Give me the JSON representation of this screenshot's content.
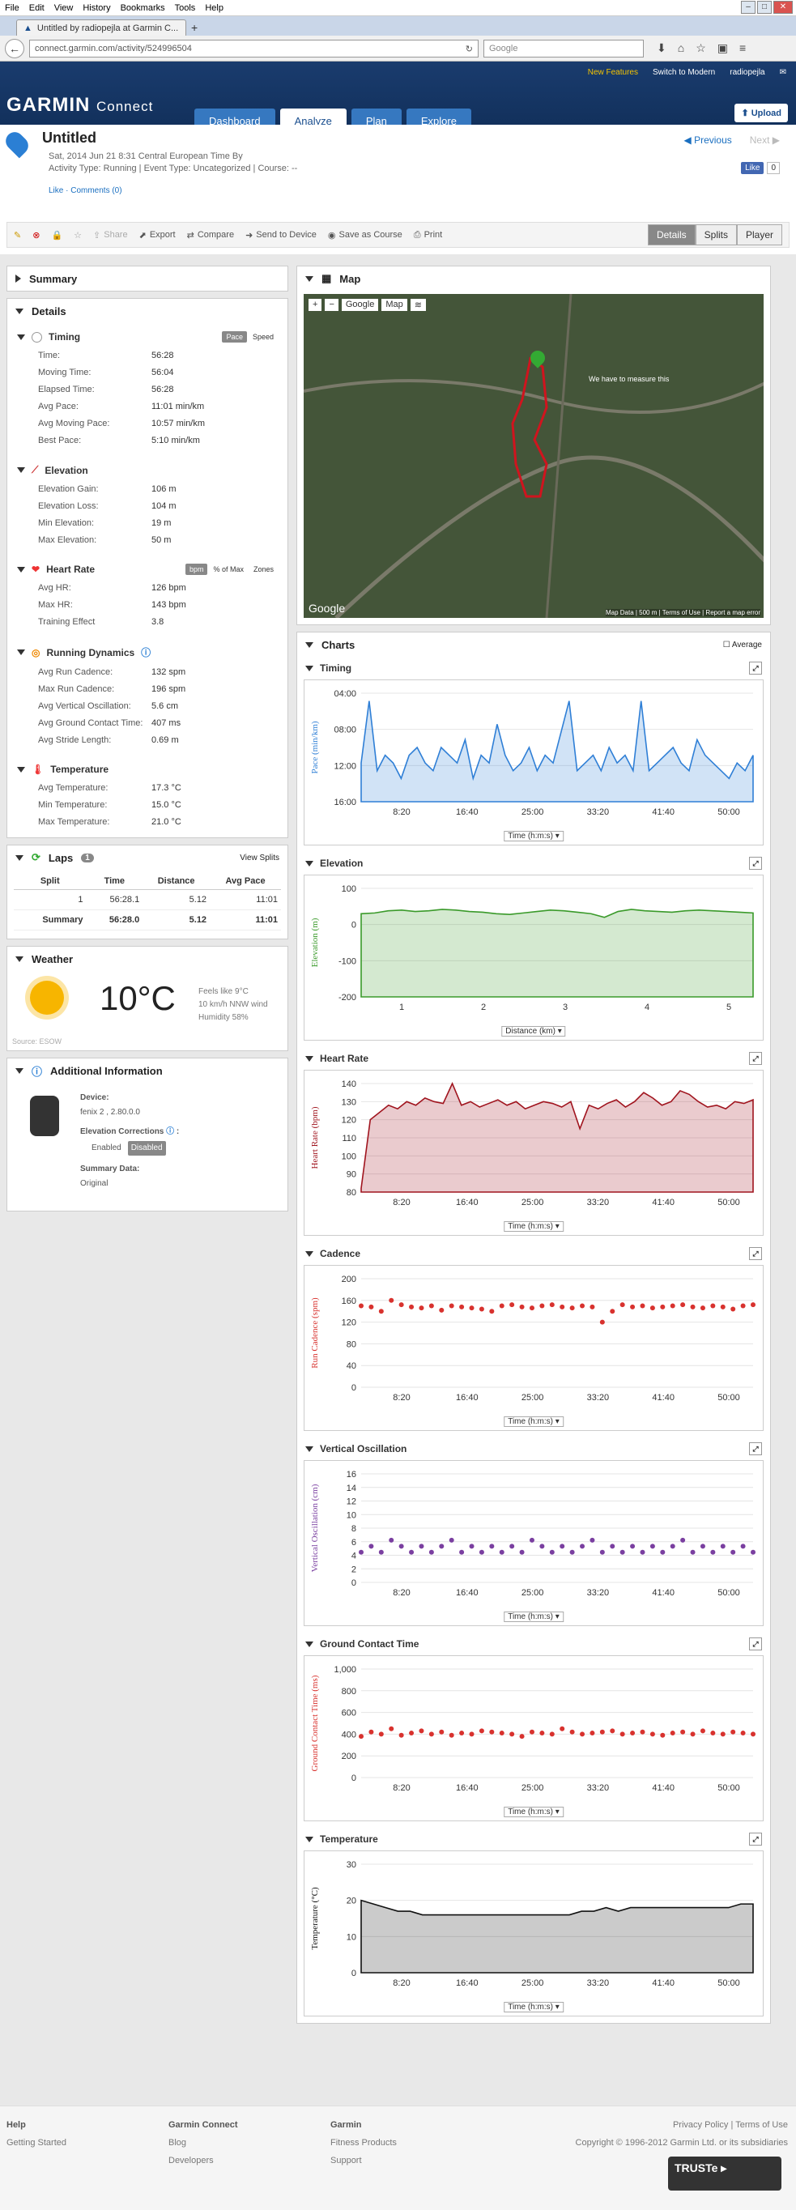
{
  "browser": {
    "menu": [
      "File",
      "Edit",
      "View",
      "History",
      "Bookmarks",
      "Tools",
      "Help"
    ],
    "tab_title": "Untitled by radiopejla at Garmin C...",
    "url": "connect.garmin.com/activity/524996504",
    "search_placeholder": "Google"
  },
  "header": {
    "new_features": "New Features",
    "switch": "Switch to Modern",
    "user": "radiopejla",
    "logo": "GARMIN",
    "logo_sub": "Connect",
    "nav": [
      "Dashboard",
      "Analyze",
      "Plan",
      "Explore"
    ],
    "upload": "Upload"
  },
  "activity": {
    "title": "Untitled",
    "date_line": "Sat, 2014 Jun 21 8:31 Central European Time By",
    "type_line": "Activity Type: Running | Event Type: Uncategorized | Course: --",
    "like_line": "Like · Comments (0)",
    "previous": "Previous",
    "next": "Next",
    "fb_like": "Like",
    "fb_count": "0"
  },
  "toolbar": {
    "share": "Share",
    "export": "Export",
    "compare": "Compare",
    "send": "Send to Device",
    "save_course": "Save as Course",
    "print": "Print",
    "views": [
      "Details",
      "Splits",
      "Player"
    ]
  },
  "summary": {
    "title": "Summary"
  },
  "details": {
    "title": "Details",
    "timing": {
      "title": "Timing",
      "toggle": [
        "Pace",
        "Speed"
      ],
      "rows": [
        [
          "Time:",
          "56:28"
        ],
        [
          "Moving Time:",
          "56:04"
        ],
        [
          "Elapsed Time:",
          "56:28"
        ],
        [
          "Avg Pace:",
          "11:01 min/km"
        ],
        [
          "Avg Moving Pace:",
          "10:57 min/km"
        ],
        [
          "Best Pace:",
          "5:10 min/km"
        ]
      ]
    },
    "elevation": {
      "title": "Elevation",
      "rows": [
        [
          "Elevation Gain:",
          "106 m"
        ],
        [
          "Elevation Loss:",
          "104 m"
        ],
        [
          "Min Elevation:",
          "19 m"
        ],
        [
          "Max Elevation:",
          "50 m"
        ]
      ]
    },
    "heart": {
      "title": "Heart Rate",
      "toggle": [
        "bpm",
        "% of Max",
        "Zones"
      ],
      "rows": [
        [
          "Avg HR:",
          "126 bpm"
        ],
        [
          "Max HR:",
          "143 bpm"
        ],
        [
          "Training Effect",
          "3.8"
        ]
      ]
    },
    "dynamics": {
      "title": "Running Dynamics",
      "rows": [
        [
          "Avg Run Cadence:",
          "132 spm"
        ],
        [
          "Max Run Cadence:",
          "196 spm"
        ],
        [
          "Avg Vertical Oscillation:",
          "5.6 cm"
        ],
        [
          "Avg Ground Contact Time:",
          "407 ms"
        ],
        [
          "Avg Stride Length:",
          "0.69 m"
        ]
      ]
    },
    "temperature": {
      "title": "Temperature",
      "rows": [
        [
          "Avg Temperature:",
          "17.3 °C"
        ],
        [
          "Min Temperature:",
          "15.0 °C"
        ],
        [
          "Max Temperature:",
          "21.0 °C"
        ]
      ]
    }
  },
  "laps": {
    "title": "Laps",
    "count": "1",
    "view_splits": "View Splits",
    "headers": [
      "Split",
      "Time",
      "Distance",
      "Avg Pace"
    ],
    "rows": [
      [
        "1",
        "56:28.1",
        "5.12",
        "11:01"
      ],
      [
        "Summary",
        "56:28.0",
        "5.12",
        "11:01"
      ]
    ]
  },
  "weather": {
    "title": "Weather",
    "temp": "10°C",
    "feels": "Feels like 9°C",
    "wind": "10 km/h NNW wind",
    "humidity": "Humidity 58%",
    "source": "Source: ESOW"
  },
  "additional": {
    "title": "Additional Information",
    "device_label": "Device:",
    "device": "fenix 2 , 2.80.0.0",
    "elev_corr": "Elevation Corrections",
    "enabled": "Enabled",
    "disabled": "Disabled",
    "summary_label": "Summary Data:",
    "summary_value": "Original"
  },
  "map": {
    "title": "Map",
    "provider": "Google",
    "type": "Map",
    "annotation": "We have to measure this",
    "footer": "Map Data | 500 m | Terms of Use | Report a map error",
    "google": "Google"
  },
  "charts_section": {
    "title": "Charts",
    "average": "Average",
    "time_select": "Time (h:m:s)",
    "dist_select": "Distance (km)"
  },
  "chart_data": [
    {
      "type": "area",
      "title": "Timing",
      "ylabel": "Pace (min/km)",
      "ylim": [
        "04:00",
        "16:00"
      ],
      "yticks": [
        "04:00",
        "08:00",
        "12:00",
        "16:00"
      ],
      "xticks": [
        "8:20",
        "16:40",
        "25:00",
        "33:20",
        "41:40",
        "50:00"
      ],
      "color": "#2f7fd6",
      "values": [
        9,
        17,
        8,
        10,
        9,
        7,
        10,
        11,
        9,
        8,
        11,
        10,
        9,
        12,
        7,
        10,
        9,
        14,
        10,
        8,
        9,
        11,
        8,
        10,
        9,
        13,
        17,
        8,
        9,
        10,
        8,
        11,
        9,
        10,
        8,
        17,
        8,
        9,
        10,
        11,
        9,
        8,
        12,
        10,
        9,
        8,
        7,
        9,
        8,
        10
      ]
    },
    {
      "type": "area",
      "title": "Elevation",
      "ylabel": "Elevation (m)",
      "ylim": [
        -200,
        100
      ],
      "yticks": [
        "100",
        "0",
        "-100",
        "-200"
      ],
      "xticks": [
        "1",
        "2",
        "3",
        "4",
        "5"
      ],
      "color": "#3a9a2a",
      "values": [
        30,
        32,
        38,
        40,
        36,
        38,
        42,
        40,
        36,
        34,
        30,
        28,
        32,
        36,
        40,
        38,
        34,
        30,
        20,
        36,
        42,
        38,
        36,
        34,
        38,
        40,
        38,
        36,
        34,
        32
      ]
    },
    {
      "type": "area",
      "title": "Heart Rate",
      "ylabel": "Heart Rate (bpm)",
      "ylim": [
        80,
        140
      ],
      "yticks": [
        "140",
        "130",
        "120",
        "110",
        "100",
        "90",
        "80"
      ],
      "xticks": [
        "8:20",
        "16:40",
        "25:00",
        "33:20",
        "41:40",
        "50:00"
      ],
      "color": "#a0141e",
      "values": [
        82,
        120,
        124,
        128,
        126,
        130,
        128,
        132,
        130,
        129,
        140,
        128,
        130,
        127,
        129,
        131,
        128,
        130,
        126,
        128,
        130,
        129,
        127,
        130,
        115,
        128,
        126,
        129,
        131,
        127,
        130,
        135,
        132,
        128,
        130,
        136,
        134,
        130,
        127,
        128,
        126,
        130,
        129,
        131
      ]
    },
    {
      "type": "scatter",
      "title": "Cadence",
      "ylabel": "Run Cadence (spm)",
      "ylim": [
        0,
        200
      ],
      "yticks": [
        "200",
        "160",
        "120",
        "80",
        "40",
        "0"
      ],
      "xticks": [
        "8:20",
        "16:40",
        "25:00",
        "33:20",
        "41:40",
        "50:00"
      ],
      "color": "#d8322e",
      "values": [
        150,
        148,
        140,
        160,
        152,
        148,
        146,
        150,
        142,
        150,
        148,
        146,
        144,
        140,
        150,
        152,
        148,
        146,
        150,
        152,
        148,
        146,
        150,
        148,
        120,
        140,
        152,
        148,
        150,
        146,
        148,
        150,
        152,
        148,
        146,
        150,
        148,
        144,
        150,
        152
      ]
    },
    {
      "type": "scatter",
      "title": "Vertical Oscillation",
      "ylabel": "Vertical Oscillation (cm)",
      "ylim": [
        0,
        18
      ],
      "yticks": [
        "16",
        "14",
        "12",
        "10",
        "8",
        "6",
        "4",
        "2",
        "0"
      ],
      "xticks": [
        "8:20",
        "16:40",
        "25:00",
        "33:20",
        "41:40",
        "50:00"
      ],
      "color": "#7a3fa0",
      "values": [
        5,
        6,
        5,
        7,
        6,
        5,
        6,
        5,
        6,
        7,
        5,
        6,
        5,
        6,
        5,
        6,
        5,
        7,
        6,
        5,
        6,
        5,
        6,
        7,
        5,
        6,
        5,
        6,
        5,
        6,
        5,
        6,
        7,
        5,
        6,
        5,
        6,
        5,
        6,
        5
      ]
    },
    {
      "type": "scatter",
      "title": "Ground Contact Time",
      "ylabel": "Ground Contact Time (ms)",
      "ylim": [
        0,
        1000
      ],
      "yticks": [
        "1,000",
        "800",
        "600",
        "400",
        "200",
        "0"
      ],
      "xticks": [
        "8:20",
        "16:40",
        "25:00",
        "33:20",
        "41:40",
        "50:00"
      ],
      "color": "#d8322e",
      "values": [
        380,
        420,
        400,
        450,
        390,
        410,
        430,
        400,
        420,
        390,
        410,
        400,
        430,
        420,
        410,
        400,
        380,
        420,
        410,
        400,
        450,
        420,
        400,
        410,
        420,
        430,
        400,
        410,
        420,
        400,
        390,
        410,
        420,
        400,
        430,
        410,
        400,
        420,
        410,
        400
      ]
    },
    {
      "type": "area",
      "title": "Temperature",
      "ylabel": "Temperature (°C)",
      "ylim": [
        0,
        30
      ],
      "yticks": [
        "30",
        "20",
        "10",
        "0"
      ],
      "xticks": [
        "8:20",
        "16:40",
        "25:00",
        "33:20",
        "41:40",
        "50:00"
      ],
      "color": "#111111",
      "values": [
        20,
        19,
        18,
        17,
        17,
        16,
        16,
        16,
        16,
        16,
        16,
        16,
        16,
        16,
        16,
        16,
        16,
        16,
        17,
        17,
        18,
        17,
        18,
        18,
        18,
        18,
        18,
        18,
        18,
        18,
        18,
        19,
        19
      ]
    }
  ],
  "footer": {
    "help": "Help",
    "getting_started": "Getting Started",
    "gc": "Garmin Connect",
    "blog": "Blog",
    "developers": "Developers",
    "garmin": "Garmin",
    "fitness": "Fitness Products",
    "support": "Support",
    "policy": "Privacy Policy | Terms of Use",
    "copyright": "Copyright © 1996-2012 Garmin Ltd. or its subsidiaries",
    "truste": "TRUSTe"
  }
}
